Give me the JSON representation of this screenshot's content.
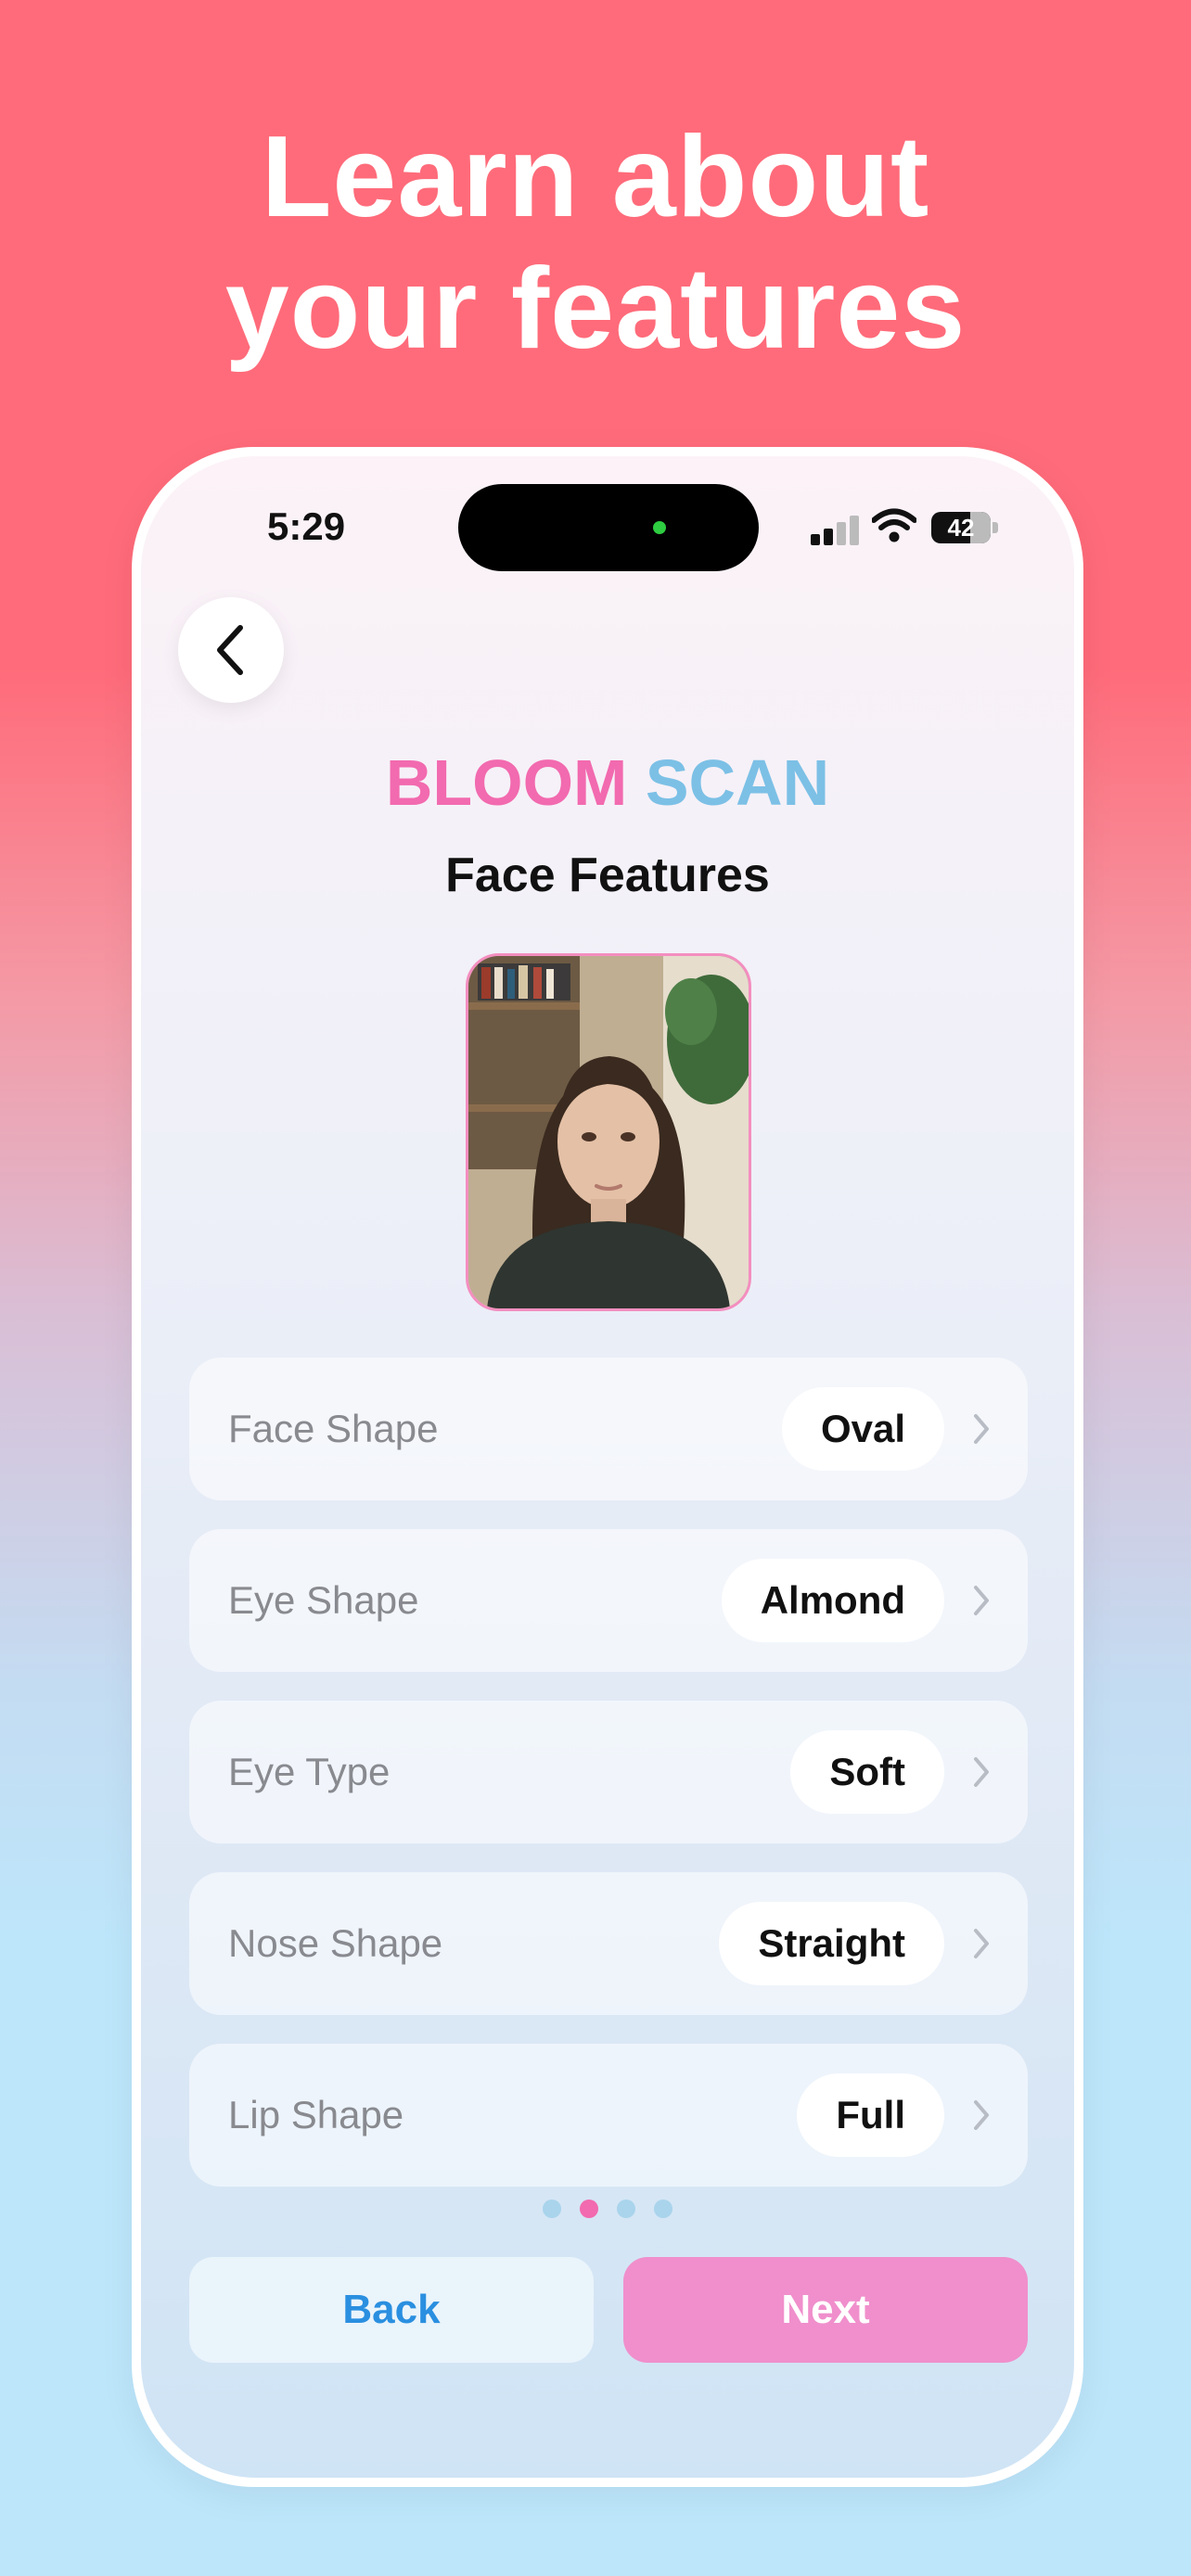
{
  "headline": {
    "line1": "Learn about",
    "line2": "your features"
  },
  "status_bar": {
    "time": "5:29",
    "battery": "42"
  },
  "nav": {
    "back_icon": "chevron-left-icon"
  },
  "brand": {
    "part1": "BLOOM",
    "part2": "SCAN"
  },
  "page": {
    "subtitle": "Face Features"
  },
  "features": [
    {
      "label": "Face Shape",
      "value": "Oval"
    },
    {
      "label": "Eye Shape",
      "value": "Almond"
    },
    {
      "label": "Eye Type",
      "value": "Soft"
    },
    {
      "label": "Nose Shape",
      "value": "Straight"
    },
    {
      "label": "Lip Shape",
      "value": "Full"
    }
  ],
  "pagination": {
    "total": 4,
    "active": 2
  },
  "buttons": {
    "back": "Back",
    "next": "Next"
  },
  "colors": {
    "brand_pink": "#f26aaf",
    "brand_blue": "#7cc0e6",
    "next_button": "#f08fcc",
    "back_text": "#2a8fe0",
    "top_background": "#ff6b7a",
    "bottom_background": "#bde6fb"
  }
}
